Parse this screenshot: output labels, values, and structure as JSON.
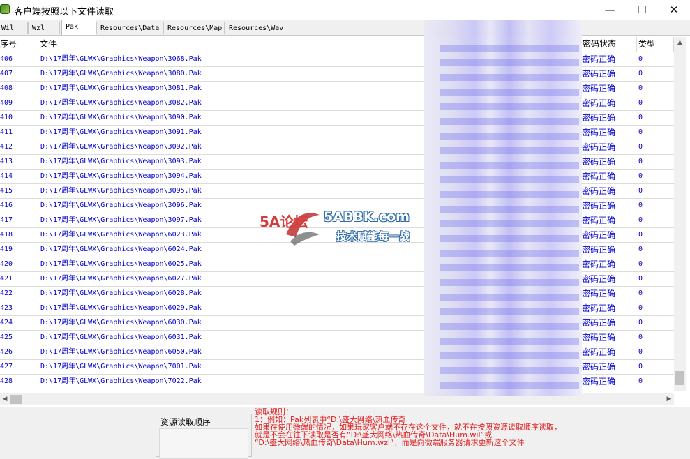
{
  "window": {
    "title": "客户端按照以下文件读取",
    "minimize": "—",
    "maximize": "☐",
    "close": "✕"
  },
  "tabs": [
    {
      "label": "Wil",
      "active": false
    },
    {
      "label": "Wzl",
      "active": false
    },
    {
      "label": "Pak",
      "active": true
    },
    {
      "label": "Resources\\Data",
      "active": false
    },
    {
      "label": "Resources\\Map",
      "active": false
    },
    {
      "label": "Resources\\Wav",
      "active": false
    }
  ],
  "table": {
    "columns": [
      "序号",
      "文件",
      "密码状态",
      "类型"
    ],
    "rows": [
      {
        "idx": "406",
        "file": "D:\\17周年\\GLWX\\Graphics\\Weapon\\3068.Pak",
        "status": "密码正确",
        "type": "0"
      },
      {
        "idx": "407",
        "file": "D:\\17周年\\GLWX\\Graphics\\Weapon\\3080.Pak",
        "status": "密码正确",
        "type": "0"
      },
      {
        "idx": "408",
        "file": "D:\\17周年\\GLWX\\Graphics\\Weapon\\3081.Pak",
        "status": "密码正确",
        "type": "0"
      },
      {
        "idx": "409",
        "file": "D:\\17周年\\GLWX\\Graphics\\Weapon\\3082.Pak",
        "status": "密码正确",
        "type": "0"
      },
      {
        "idx": "410",
        "file": "D:\\17周年\\GLWX\\Graphics\\Weapon\\3090.Pak",
        "status": "密码正确",
        "type": "0"
      },
      {
        "idx": "411",
        "file": "D:\\17周年\\GLWX\\Graphics\\Weapon\\3091.Pak",
        "status": "密码正确",
        "type": "0"
      },
      {
        "idx": "412",
        "file": "D:\\17周年\\GLWX\\Graphics\\Weapon\\3092.Pak",
        "status": "密码正确",
        "type": "0"
      },
      {
        "idx": "413",
        "file": "D:\\17周年\\GLWX\\Graphics\\Weapon\\3093.Pak",
        "status": "密码正确",
        "type": "0"
      },
      {
        "idx": "414",
        "file": "D:\\17周年\\GLWX\\Graphics\\Weapon\\3094.Pak",
        "status": "密码正确",
        "type": "0"
      },
      {
        "idx": "415",
        "file": "D:\\17周年\\GLWX\\Graphics\\Weapon\\3095.Pak",
        "status": "密码正确",
        "type": "0"
      },
      {
        "idx": "416",
        "file": "D:\\17周年\\GLWX\\Graphics\\Weapon\\3096.Pak",
        "status": "密码正确",
        "type": "0"
      },
      {
        "idx": "417",
        "file": "D:\\17周年\\GLWX\\Graphics\\Weapon\\3097.Pak",
        "status": "密码正确",
        "type": "0"
      },
      {
        "idx": "418",
        "file": "D:\\17周年\\GLWX\\Graphics\\Weapon\\6023.Pak",
        "status": "密码正确",
        "type": "0"
      },
      {
        "idx": "419",
        "file": "D:\\17周年\\GLWX\\Graphics\\Weapon\\6024.Pak",
        "status": "密码正确",
        "type": "0"
      },
      {
        "idx": "420",
        "file": "D:\\17周年\\GLWX\\Graphics\\Weapon\\6025.Pak",
        "status": "密码正确",
        "type": "0"
      },
      {
        "idx": "421",
        "file": "D:\\17周年\\GLWX\\Graphics\\Weapon\\6027.Pak",
        "status": "密码正确",
        "type": "0"
      },
      {
        "idx": "422",
        "file": "D:\\17周年\\GLWX\\Graphics\\Weapon\\6028.Pak",
        "status": "密码正确",
        "type": "0"
      },
      {
        "idx": "423",
        "file": "D:\\17周年\\GLWX\\Graphics\\Weapon\\6029.Pak",
        "status": "密码正确",
        "type": "0"
      },
      {
        "idx": "424",
        "file": "D:\\17周年\\GLWX\\Graphics\\Weapon\\6030.Pak",
        "status": "密码正确",
        "type": "0"
      },
      {
        "idx": "425",
        "file": "D:\\17周年\\GLWX\\Graphics\\Weapon\\6031.Pak",
        "status": "密码正确",
        "type": "0"
      },
      {
        "idx": "426",
        "file": "D:\\17周年\\GLWX\\Graphics\\Weapon\\6050.Pak",
        "status": "密码正确",
        "type": "0"
      },
      {
        "idx": "427",
        "file": "D:\\17周年\\GLWX\\Graphics\\Weapon\\7001.Pak",
        "status": "密码正确",
        "type": "0"
      },
      {
        "idx": "428",
        "file": "D:\\17周年\\GLWX\\Graphics\\Weapon\\7022.Pak",
        "status": "密码正确",
        "type": "0"
      }
    ]
  },
  "watermark": {
    "logo": "5A论坛",
    "site": "5ABBK.com",
    "slogan": "技术赋能每一战"
  },
  "bottom": {
    "resource_order_label": "资源读取顺序",
    "rules_lines": [
      "读取规则：",
      "1：例如：Pak列表中“D:\\盛大网络\\热血传奇",
      "    如果在使用微端的情况，如果玩家客户端不存在这个文件，就不在按照资源读取顺序读取，",
      "    就是不会在往下读取是否有“D:\\盛大网络\\热血传奇\\Data\\Hum.wil”或",
      "    “D:\\盛大网络\\热血传奇\\Data\\Hum.wzl”，而是向微端服务器请求更新这个文件"
    ]
  },
  "colors": {
    "row_text": "#0000cc",
    "rules_text": "#e02020",
    "titlebar_bg": "#ffffff",
    "window_bg": "#f0f0f0"
  }
}
